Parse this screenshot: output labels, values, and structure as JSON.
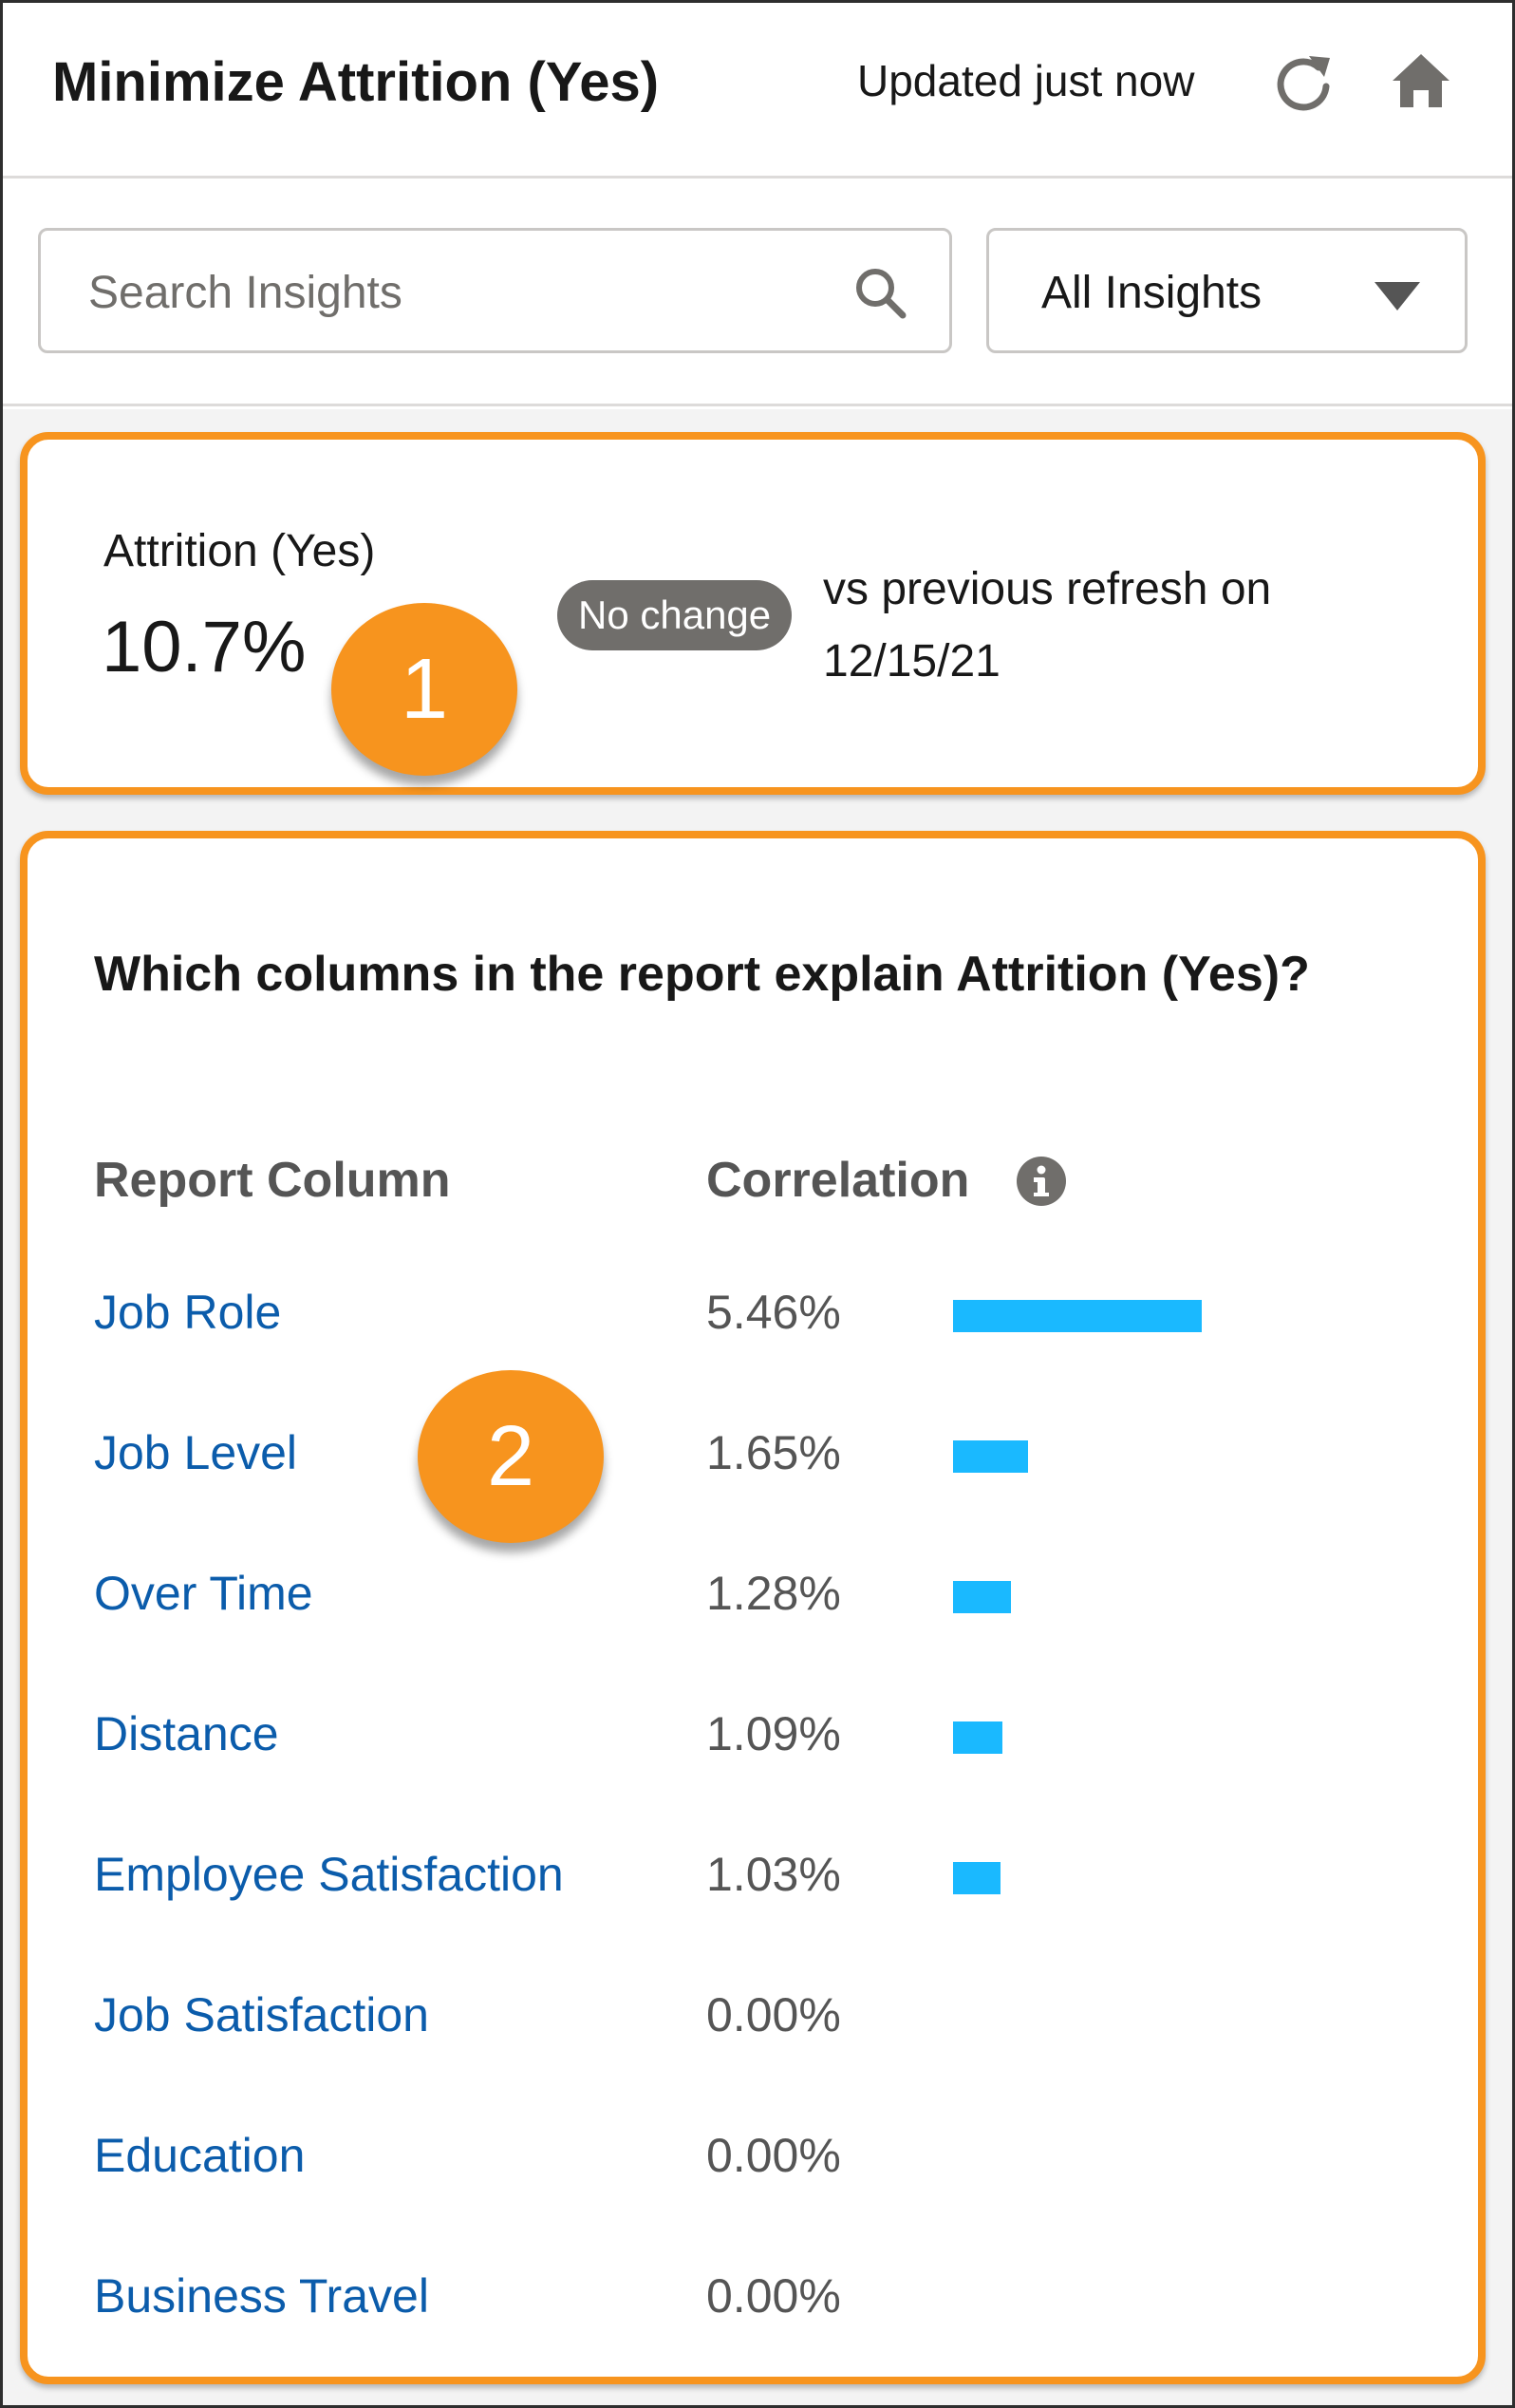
{
  "header": {
    "title": "Minimize Attrition (Yes)",
    "updated": "Updated just now",
    "refresh_icon": "refresh-icon",
    "home_icon": "home-icon"
  },
  "search": {
    "placeholder": "Search Insights",
    "value": "",
    "icon": "search-icon"
  },
  "filter": {
    "selected": "All Insights",
    "icon": "chevron-down-icon"
  },
  "kpi": {
    "label": "Attrition (Yes)",
    "value": "10.7%",
    "badge": "No change",
    "comparison": "vs previous refresh on 12/15/21"
  },
  "callouts": [
    "1",
    "2"
  ],
  "insight": {
    "question": "Which columns in the report explain Attrition (Yes)?",
    "column_header": "Report Column",
    "correlation_header": "Correlation",
    "info_icon": "info-icon",
    "rows": [
      {
        "column": "Job Role",
        "correlation": "5.46%",
        "value": 5.46
      },
      {
        "column": "Job Level",
        "correlation": "1.65%",
        "value": 1.65
      },
      {
        "column": "Over Time",
        "correlation": "1.28%",
        "value": 1.28
      },
      {
        "column": "Distance",
        "correlation": "1.09%",
        "value": 1.09
      },
      {
        "column": "Employee Satisfaction",
        "correlation": "1.03%",
        "value": 1.03
      },
      {
        "column": "Job Satisfaction",
        "correlation": "0.00%",
        "value": 0
      },
      {
        "column": "Education",
        "correlation": "0.00%",
        "value": 0
      },
      {
        "column": "Business Travel",
        "correlation": "0.00%",
        "value": 0
      }
    ]
  },
  "colors": {
    "accent": "#f7941e",
    "bar": "#1ab9ff",
    "link": "#0b5cab",
    "badge": "#706e6b"
  }
}
